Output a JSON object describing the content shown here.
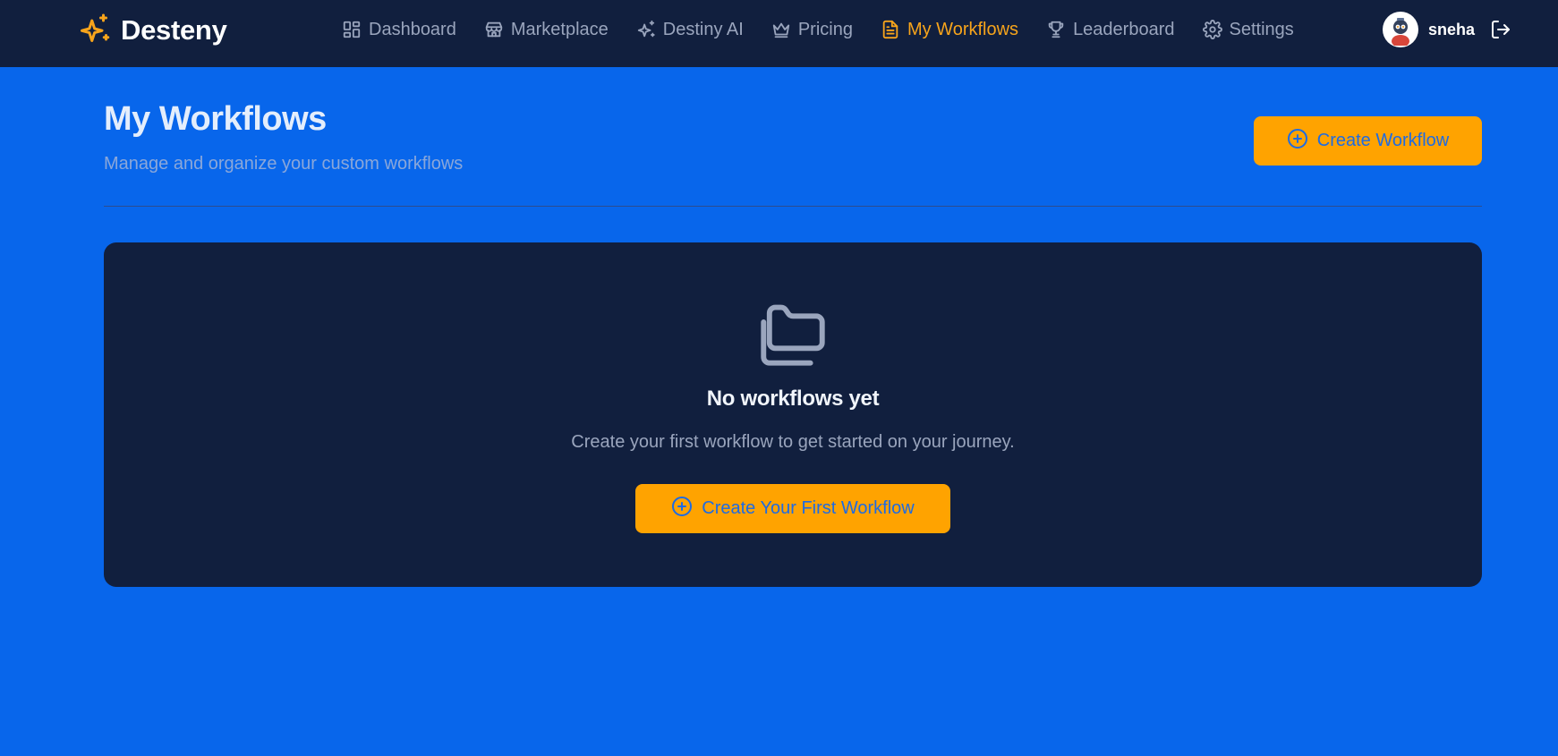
{
  "app": {
    "brand_name": "Desteny",
    "brand_icon": "sparkles-icon",
    "accent_color": "#f7a41b",
    "background_color": "#0866eb",
    "surface_color": "#111f3e"
  },
  "nav": {
    "items": [
      {
        "label": "Dashboard",
        "icon": "dashboard-icon",
        "active": false
      },
      {
        "label": "Marketplace",
        "icon": "store-icon",
        "active": false
      },
      {
        "label": "Destiny AI",
        "icon": "sparkles-icon",
        "active": false
      },
      {
        "label": "Pricing",
        "icon": "crown-icon",
        "active": false
      },
      {
        "label": "My Workflows",
        "icon": "document-icon",
        "active": true
      },
      {
        "label": "Leaderboard",
        "icon": "trophy-icon",
        "active": false
      },
      {
        "label": "Settings",
        "icon": "gear-icon",
        "active": false
      }
    ]
  },
  "user": {
    "name": "sneha",
    "avatar_icon": "avatar",
    "logout_icon": "logout-icon"
  },
  "page": {
    "title": "My Workflows",
    "subtitle": "Manage and organize your custom workflows",
    "create_button_label": "Create Workflow",
    "create_button_icon": "plus-circle-icon"
  },
  "empty_state": {
    "icon": "folders-icon",
    "title": "No workflows yet",
    "text": "Create your first workflow to get started on your journey.",
    "button_label": "Create Your First Workflow",
    "button_icon": "plus-circle-icon"
  }
}
